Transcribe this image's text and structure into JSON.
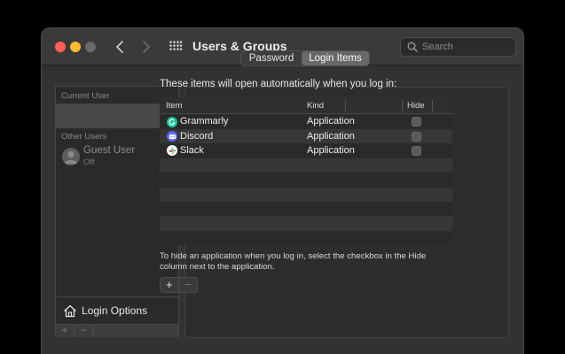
{
  "window": {
    "title": "Users & Groups",
    "search_placeholder": "Search"
  },
  "sidebar": {
    "current_user_label": "Current User",
    "other_users_label": "Other Users",
    "guest": {
      "name": "Guest User",
      "status": "Off"
    },
    "login_options_label": "Login Options",
    "add_label": "+",
    "remove_label": "−"
  },
  "tabs": [
    {
      "label": "Password",
      "selected": false
    },
    {
      "label": "Login Items",
      "selected": true
    }
  ],
  "login_items": {
    "intro": "These items will open automatically when you log in:",
    "columns": {
      "item": "Item",
      "kind": "Kind",
      "hide": "Hide"
    },
    "rows": [
      {
        "name": "Grammarly",
        "kind": "Application",
        "hide": false,
        "icon": "grammarly-icon",
        "color": "#15c39a"
      },
      {
        "name": "Discord",
        "kind": "Application",
        "hide": false,
        "icon": "discord-icon",
        "color": "#5865f2"
      },
      {
        "name": "Slack",
        "kind": "Application",
        "hide": false,
        "icon": "slack-icon",
        "color": "#ffffff"
      }
    ],
    "hint": "To hide an application when you log in, select the checkbox in the Hide column next to the application.",
    "add_label": "+",
    "remove_label": "−"
  }
}
